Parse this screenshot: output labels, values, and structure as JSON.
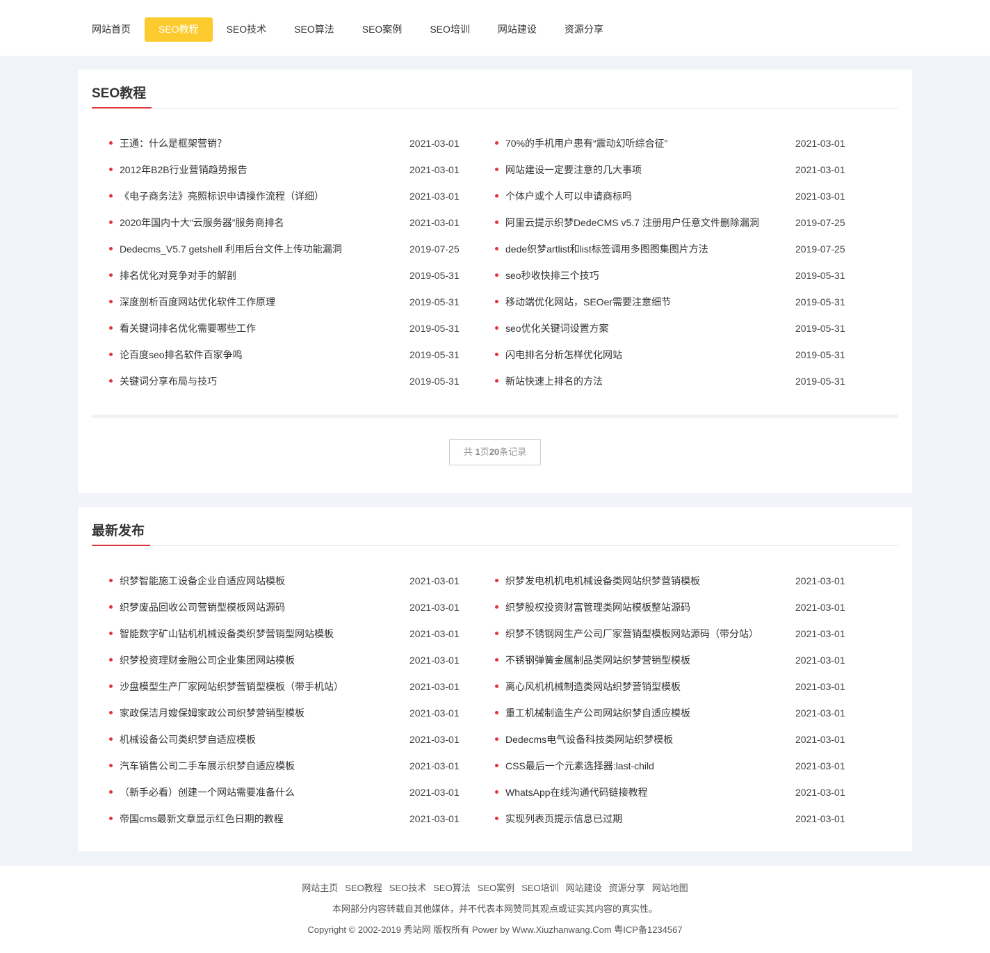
{
  "nav": {
    "items": [
      {
        "label": "网站首页",
        "active": false
      },
      {
        "label": "SEO教程",
        "active": true
      },
      {
        "label": "SEO技术",
        "active": false
      },
      {
        "label": "SEO算法",
        "active": false
      },
      {
        "label": "SEO案例",
        "active": false
      },
      {
        "label": "SEO培训",
        "active": false
      },
      {
        "label": "网站建设",
        "active": false
      },
      {
        "label": "资源分享",
        "active": false
      }
    ]
  },
  "section1": {
    "title": "SEO教程",
    "items": [
      {
        "title": "王通：什么是框架营销？",
        "date": "2021-03-01"
      },
      {
        "title": "70%的手机用户患有“震动幻听综合征”",
        "date": "2021-03-01"
      },
      {
        "title": "2012年B2B行业营销趋势报告",
        "date": "2021-03-01"
      },
      {
        "title": "网站建设一定要注意的几大事项",
        "date": "2021-03-01"
      },
      {
        "title": "《电子商务法》亮照标识申请操作流程（详细）",
        "date": "2021-03-01"
      },
      {
        "title": "个体户或个人可以申请商标吗",
        "date": "2021-03-01"
      },
      {
        "title": "2020年国内十大“云服务器”服务商排名",
        "date": "2021-03-01"
      },
      {
        "title": "阿里云提示织梦DedeCMS v5.7 注册用户任意文件删除漏洞",
        "date": "2019-07-25"
      },
      {
        "title": "Dedecms_V5.7 getshell 利用后台文件上传功能漏洞",
        "date": "2019-07-25"
      },
      {
        "title": "dede织梦artlist和list标签调用多图图集图片方法",
        "date": "2019-07-25"
      },
      {
        "title": "排名优化对竞争对手的解剖",
        "date": "2019-05-31"
      },
      {
        "title": "seo秒收快排三个技巧",
        "date": "2019-05-31"
      },
      {
        "title": "深度剖析百度网站优化软件工作原理",
        "date": "2019-05-31"
      },
      {
        "title": "移动端优化网站，SEOer需要注意细节",
        "date": "2019-05-31"
      },
      {
        "title": "看关键词排名优化需要哪些工作",
        "date": "2019-05-31"
      },
      {
        "title": "seo优化关键词设置方案",
        "date": "2019-05-31"
      },
      {
        "title": "论百度seo排名软件百家争鸣",
        "date": "2019-05-31"
      },
      {
        "title": "闪电排名分析怎样优化网站",
        "date": "2019-05-31"
      },
      {
        "title": "关键词分享布局与技巧",
        "date": "2019-05-31"
      },
      {
        "title": "新站快速上排名的方法",
        "date": "2019-05-31"
      }
    ],
    "pager": {
      "prefix": "共 ",
      "pages": "1",
      "mid": "页",
      "count": "20",
      "suffix": "条记录"
    }
  },
  "section2": {
    "title": "最新发布",
    "items": [
      {
        "title": "织梦智能施工设备企业自适应网站模板",
        "date": "2021-03-01"
      },
      {
        "title": "织梦发电机机电机械设备类网站织梦营销模板",
        "date": "2021-03-01"
      },
      {
        "title": "织梦废品回收公司营销型模板网站源码",
        "date": "2021-03-01"
      },
      {
        "title": "织梦股权投资财富管理类网站模板整站源码",
        "date": "2021-03-01"
      },
      {
        "title": "智能数字矿山钻机机械设备类织梦营销型网站模板",
        "date": "2021-03-01"
      },
      {
        "title": "织梦不锈钢网生产公司厂家营销型模板网站源码（带分站）",
        "date": "2021-03-01"
      },
      {
        "title": "织梦投资理财金融公司企业集团网站模板",
        "date": "2021-03-01"
      },
      {
        "title": "不锈钢弹簧金属制品类网站织梦营销型模板",
        "date": "2021-03-01"
      },
      {
        "title": "沙盘模型生产厂家网站织梦营销型模板（带手机站）",
        "date": "2021-03-01"
      },
      {
        "title": "离心风机机械制造类网站织梦营销型模板",
        "date": "2021-03-01"
      },
      {
        "title": "家政保洁月嫂保姆家政公司织梦营销型模板",
        "date": "2021-03-01"
      },
      {
        "title": "重工机械制造生产公司网站织梦自适应模板",
        "date": "2021-03-01"
      },
      {
        "title": "机械设备公司类织梦自适应模板",
        "date": "2021-03-01"
      },
      {
        "title": "Dedecms电气设备科技类网站织梦模板",
        "date": "2021-03-01"
      },
      {
        "title": "汽车销售公司二手车展示织梦自适应模板",
        "date": "2021-03-01"
      },
      {
        "title": "CSS最后一个元素选择器:last-child",
        "date": "2021-03-01"
      },
      {
        "title": "（新手必看）创建一个网站需要准备什么",
        "date": "2021-03-01"
      },
      {
        "title": "WhatsApp在线沟通代码链接教程",
        "date": "2021-03-01"
      },
      {
        "title": "帝国cms最新文章显示红色日期的教程",
        "date": "2021-03-01"
      },
      {
        "title": "实现列表页提示信息已过期",
        "date": "2021-03-01"
      }
    ]
  },
  "footer": {
    "links": [
      "网站主页",
      "SEO教程",
      "SEO技术",
      "SEO算法",
      "SEO案例",
      "SEO培训",
      "网站建设",
      "资源分享",
      "网站地图"
    ],
    "note": "本网部分内容转载自其他媒体，并不代表本网赞同其观点或证实其内容的真实性。",
    "copyright": "Copyright © 2002-2019 秀站网 版权所有 Power by  Www.Xiuzhanwang.Com  粤ICP备1234567"
  },
  "colors": {
    "accent": "#fecb2f",
    "bullet": "#e0363d",
    "background": "#f0f3f8"
  }
}
